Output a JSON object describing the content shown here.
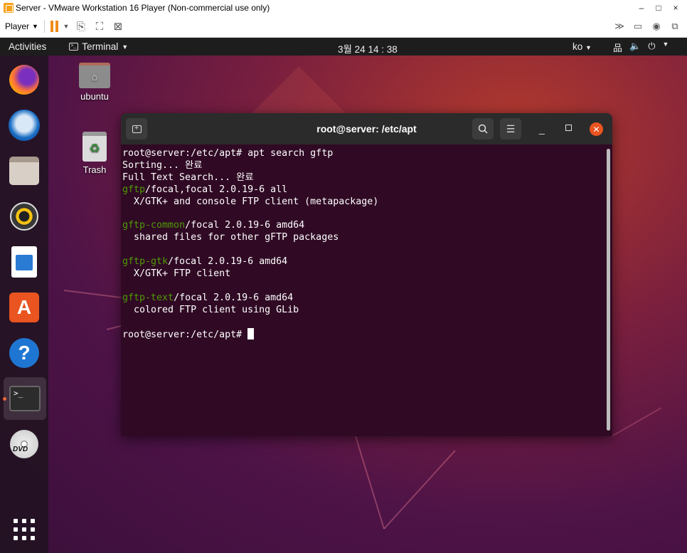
{
  "vmware": {
    "title": "Server - VMware Workstation 16 Player (Non-commercial use only)",
    "player_label": "Player",
    "win_controls": [
      "–",
      "□",
      "×"
    ]
  },
  "topbar": {
    "activities": "Activities",
    "app_menu": "Terminal",
    "clock": "3월 24  14 : 38",
    "lang": "ko"
  },
  "desktop": {
    "home_label": "ubuntu",
    "trash_label": "Trash"
  },
  "terminal": {
    "title": "root@server: /etc/apt",
    "lines": [
      {
        "plain": "root@server:/etc/apt# apt search gftp"
      },
      {
        "plain": "Sorting... 완료"
      },
      {
        "plain": "Full Text Search... 완료"
      },
      {
        "pkg": "gftp",
        "rest": "/focal,focal 2.0.19-6 all"
      },
      {
        "plain": "  X/GTK+ and console FTP client (metapackage)"
      },
      {
        "plain": ""
      },
      {
        "pkg": "gftp-common",
        "rest": "/focal 2.0.19-6 amd64"
      },
      {
        "plain": "  shared files for other gFTP packages"
      },
      {
        "plain": ""
      },
      {
        "pkg": "gftp-gtk",
        "rest": "/focal 2.0.19-6 amd64"
      },
      {
        "plain": "  X/GTK+ FTP client"
      },
      {
        "plain": ""
      },
      {
        "pkg": "gftp-text",
        "rest": "/focal 2.0.19-6 amd64"
      },
      {
        "plain": "  colored FTP client using GLib"
      },
      {
        "plain": ""
      },
      {
        "prompt": "root@server:/etc/apt# "
      }
    ]
  },
  "colors": {
    "terminal_bg": "#300a24",
    "package_name": "#4e9a06",
    "accent": "#e95420"
  }
}
